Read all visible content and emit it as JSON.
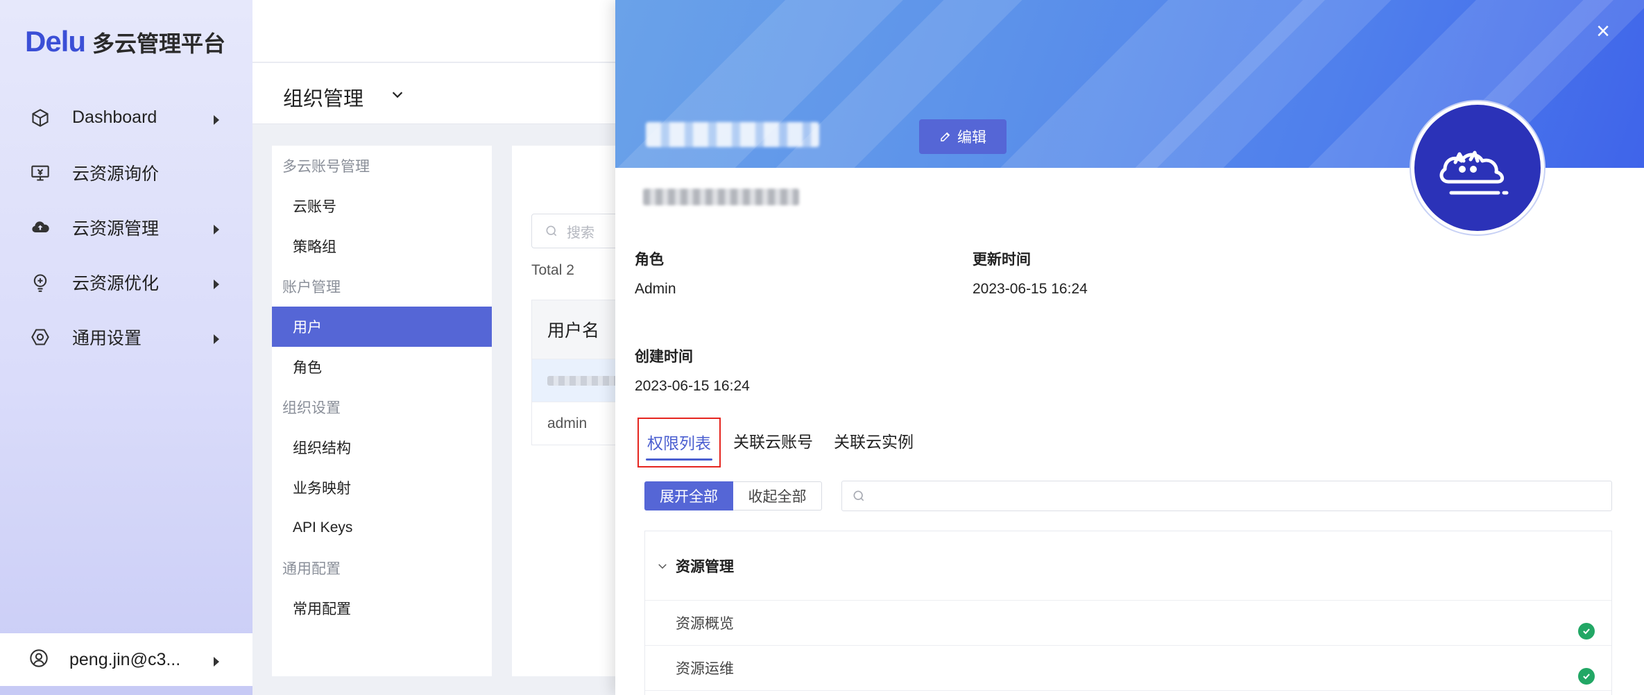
{
  "app": {
    "brand": "Delu",
    "title": "多云管理平台"
  },
  "sidebar": {
    "items": [
      {
        "label": "Dashboard",
        "icon": "cube-icon",
        "has_arrow": true
      },
      {
        "label": "云资源询价",
        "icon": "price-monitor-icon",
        "has_arrow": false
      },
      {
        "label": "云资源管理",
        "icon": "cloud-upload-icon",
        "has_arrow": true
      },
      {
        "label": "云资源优化",
        "icon": "lightbulb-icon",
        "has_arrow": true
      },
      {
        "label": "通用设置",
        "icon": "hexagon-gear-icon",
        "has_arrow": true
      }
    ],
    "user": {
      "label": "peng.jin@c3...",
      "icon": "user-circle-icon"
    }
  },
  "org_header": {
    "title": "组织管理"
  },
  "subnav": [
    {
      "type": "group",
      "label": "多云账号管理"
    },
    {
      "type": "item",
      "label": "云账号"
    },
    {
      "type": "item",
      "label": "策略组"
    },
    {
      "type": "group",
      "label": "账户管理"
    },
    {
      "type": "item",
      "label": "用户",
      "active": true
    },
    {
      "type": "item",
      "label": "角色"
    },
    {
      "type": "group",
      "label": "组织设置"
    },
    {
      "type": "item",
      "label": "组织结构"
    },
    {
      "type": "item",
      "label": "业务映射"
    },
    {
      "type": "item",
      "label": "API Keys"
    },
    {
      "type": "group",
      "label": "通用配置"
    },
    {
      "type": "item",
      "label": "常用配置"
    }
  ],
  "user_list": {
    "search_placeholder": "搜索",
    "total": "Total 2",
    "column_header": "用户名",
    "rows": [
      {
        "name": "",
        "blurred": true
      },
      {
        "name": "admin"
      }
    ]
  },
  "drawer": {
    "edit_label": "编辑",
    "close_symbol": "×",
    "fields": {
      "role_label": "角色",
      "role_value": "Admin",
      "updated_label": "更新时间",
      "updated_value": "2023-06-15 16:24",
      "created_label": "创建时间",
      "created_value": "2023-06-15 16:24"
    },
    "tabs": [
      {
        "label": "权限列表",
        "active": true
      },
      {
        "label": "关联云账号"
      },
      {
        "label": "关联云实例"
      }
    ],
    "expand_all": "展开全部",
    "collapse_all": "收起全部",
    "permissions": {
      "group": "资源管理",
      "items": [
        {
          "label": "资源概览",
          "granted": true
        },
        {
          "label": "资源运维",
          "granted": true
        }
      ]
    }
  },
  "colors": {
    "accent": "#5566d6",
    "success": "#22a765",
    "highlight": "#e5251f"
  }
}
